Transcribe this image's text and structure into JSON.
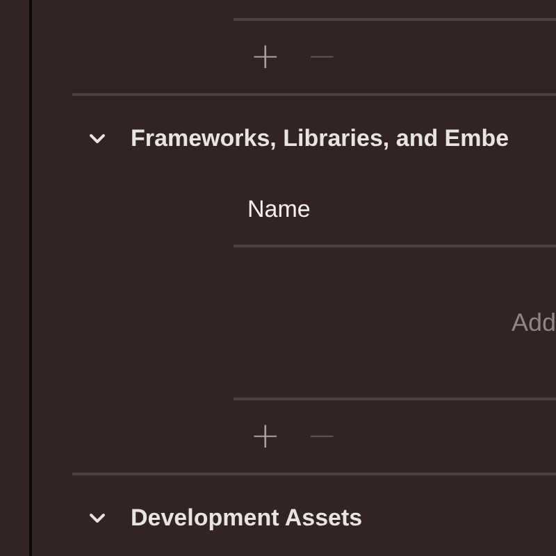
{
  "previous_section": {
    "buttons": [
      {
        "label": "+",
        "disabled": false
      },
      {
        "label": "−",
        "disabled": true
      }
    ]
  },
  "sections": [
    {
      "title": "Frameworks, Libraries, and Embe",
      "expanded": true,
      "columns": [
        "Name"
      ],
      "empty_hint": "Add",
      "buttons": [
        {
          "label": "+",
          "disabled": false
        },
        {
          "label": "−",
          "disabled": true
        }
      ]
    },
    {
      "title": "Development Assets",
      "expanded": true
    }
  ]
}
